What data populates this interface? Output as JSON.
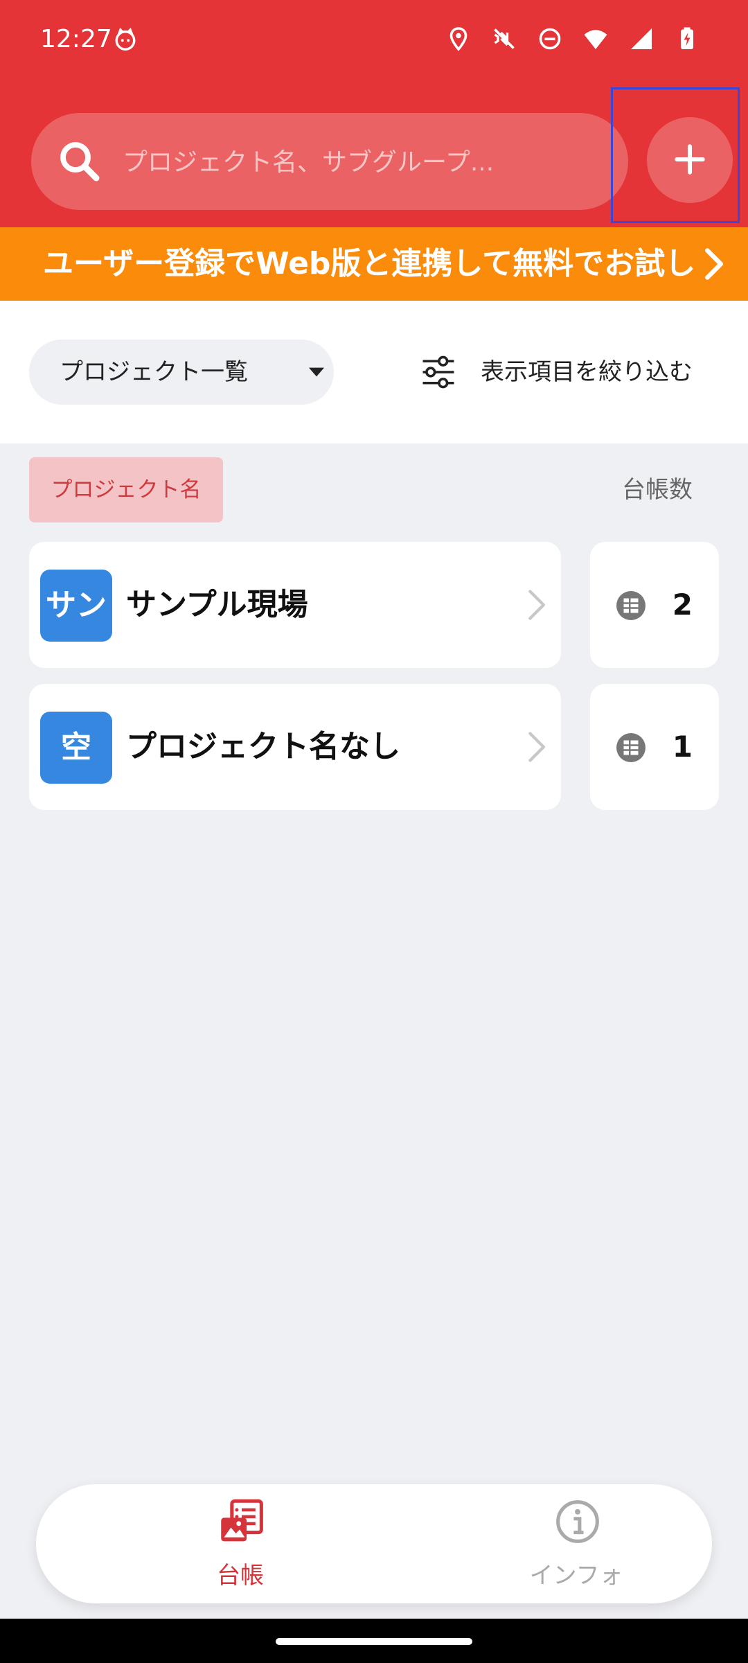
{
  "status_bar": {
    "time": "12:27",
    "icons": [
      "cat-notification-icon",
      "location-icon",
      "vibrate-off-icon",
      "do-not-disturb-icon",
      "wifi-icon",
      "cellular-signal-icon",
      "battery-charging-icon"
    ]
  },
  "header": {
    "search_placeholder": "プロジェクト名、サブグループ...",
    "add_button_icon": "plus-icon"
  },
  "banner": {
    "text": "ユーザー登録でWeb版と連携して無料でお試し"
  },
  "filter_bar": {
    "dropdown_label": "プロジェクト一覧",
    "filter_label": "表示項目を絞り込む"
  },
  "columns": {
    "name": "プロジェクト名",
    "count": "台帳数"
  },
  "projects": [
    {
      "avatar": "サン",
      "name": "サンプル現場",
      "count": "2"
    },
    {
      "avatar": "空",
      "name": "プロジェクト名なし",
      "count": "1"
    }
  ],
  "bottom_nav": {
    "items": [
      {
        "label": "台帳",
        "icon": "ledger-icon",
        "active": true
      },
      {
        "label": "インフォ",
        "icon": "info-icon",
        "active": false
      }
    ]
  },
  "colors": {
    "primary_red": "#e43438",
    "banner_orange": "#fb8c0b",
    "avatar_blue": "#3587df",
    "active_tab": "#d5343a",
    "background": "#eff0f4"
  }
}
